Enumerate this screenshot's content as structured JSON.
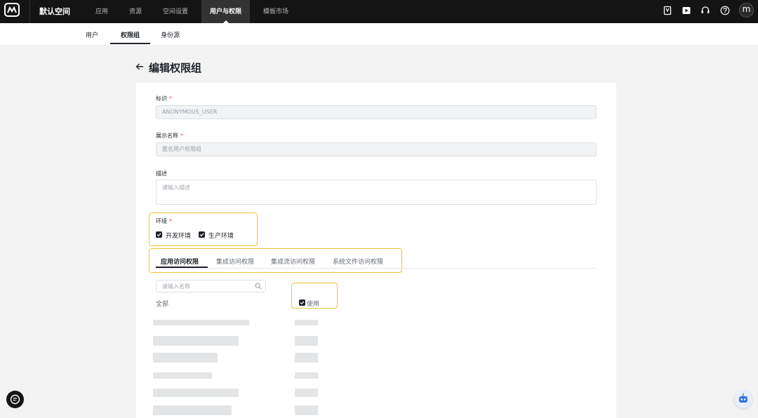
{
  "topbar": {
    "workspace": "默认空间",
    "nav": [
      "应用",
      "资源",
      "空间设置",
      "用户与权限",
      "模板市场"
    ],
    "active_nav": "用户与权限",
    "avatar_letter": "m"
  },
  "subnav": {
    "tabs": [
      "用户",
      "权限组",
      "身份源"
    ],
    "active": "权限组"
  },
  "page": {
    "title": "编辑权限组"
  },
  "form": {
    "identifier": {
      "label": "标识",
      "required_mark": "*",
      "value": "ANONYMOUS_USER"
    },
    "display_name": {
      "label": "展示名称",
      "required_mark": "*",
      "placeholder": "匿名用户权限组"
    },
    "description": {
      "label": "描述",
      "placeholder": "请输入描述"
    },
    "environment": {
      "label": "环境",
      "required_mark": "*",
      "options": [
        {
          "label": "开发环境",
          "checked": true
        },
        {
          "label": "生产环境",
          "checked": true
        }
      ]
    }
  },
  "permission_tabs": {
    "tabs": [
      "应用访问权限",
      "集成访问权限",
      "集成流访问权限",
      "系统文件访问权限"
    ],
    "active": "应用访问权限"
  },
  "list": {
    "search_placeholder": "请输入名称",
    "all_label": "全部",
    "use_label": "使用",
    "use_checked": true
  },
  "colors": {
    "topbar_bg": "#141414",
    "highlight": "#f2c233",
    "required": "#f54a45"
  }
}
